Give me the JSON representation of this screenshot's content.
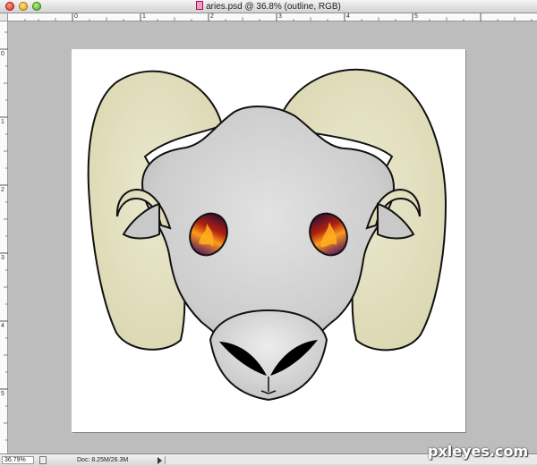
{
  "window": {
    "title": "aries.psd @ 36.8% (outline, RGB)"
  },
  "rulers": {
    "horizontal_labels": [
      "0",
      "1",
      "2",
      "3",
      "4",
      "5"
    ],
    "vertical_labels": [
      "0",
      "1",
      "2",
      "3",
      "4",
      "5"
    ]
  },
  "status": {
    "zoom": "36.79%",
    "doc_size": "Doc: 8.25M/26.3M"
  },
  "artwork": {
    "subject": "ram-head",
    "colors": {
      "horn": "#e4e0c0",
      "face": "#cfcfcf",
      "outline": "#111111",
      "nostril": "#000000",
      "eye_fire": "#e8501a"
    }
  },
  "watermark": "pxleyes.com"
}
